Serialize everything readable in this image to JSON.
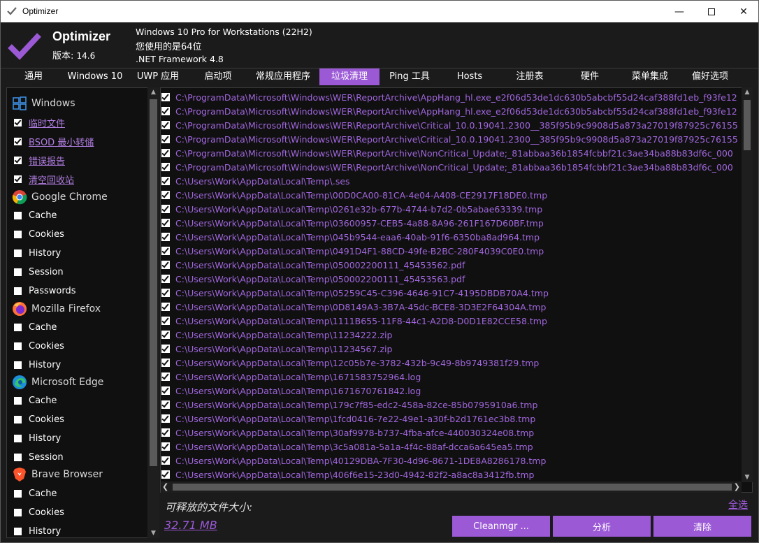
{
  "window": {
    "title": "Optimizer",
    "controls": [
      "minimize-icon",
      "maximize-icon",
      "close-icon"
    ]
  },
  "header": {
    "app_name": "Optimizer",
    "version_label": "版本:",
    "version_value": "14.6",
    "os": "Windows 10 Pro for Workstations (22H2)",
    "arch": "您使用的是64位",
    "framework": ".NET Framework 4.8"
  },
  "tabs": [
    {
      "label": "通用"
    },
    {
      "label": "Windows 10"
    },
    {
      "label": "UWP 应用"
    },
    {
      "label": "启动项"
    },
    {
      "label": "常规应用程序"
    },
    {
      "label": "垃圾清理",
      "active": true
    },
    {
      "label": "Ping 工具"
    },
    {
      "label": "Hosts"
    },
    {
      "label": "注册表"
    },
    {
      "label": "硬件"
    },
    {
      "label": "菜单集成"
    },
    {
      "label": "偏好选项"
    }
  ],
  "sidebar": {
    "windows": {
      "label": "Windows",
      "icon": "windows-logo-icon",
      "items": [
        {
          "label": "临时文件",
          "checked": true
        },
        {
          "label": "BSOD 最小转储",
          "checked": true
        },
        {
          "label": "错误报告",
          "checked": true
        },
        {
          "label": "清空回收站",
          "checked": true
        }
      ]
    },
    "chrome": {
      "label": "Google Chrome",
      "icon": "chrome-logo-icon",
      "items": [
        {
          "label": "Cache",
          "checked": false
        },
        {
          "label": "Cookies",
          "checked": false
        },
        {
          "label": "History",
          "checked": false
        },
        {
          "label": "Session",
          "checked": false
        },
        {
          "label": "Passwords",
          "checked": false
        }
      ]
    },
    "firefox": {
      "label": "Mozilla Firefox",
      "icon": "firefox-logo-icon",
      "items": [
        {
          "label": "Cache",
          "checked": false
        },
        {
          "label": "Cookies",
          "checked": false
        },
        {
          "label": "History",
          "checked": false
        }
      ]
    },
    "edge": {
      "label": "Microsoft Edge",
      "icon": "edge-logo-icon",
      "items": [
        {
          "label": "Cache",
          "checked": false
        },
        {
          "label": "Cookies",
          "checked": false
        },
        {
          "label": "History",
          "checked": false
        },
        {
          "label": "Session",
          "checked": false
        }
      ]
    },
    "brave": {
      "label": "Brave Browser",
      "icon": "brave-logo-icon",
      "items": [
        {
          "label": "Cache",
          "checked": false
        },
        {
          "label": "Cookies",
          "checked": false
        },
        {
          "label": "History",
          "checked": false
        }
      ]
    }
  },
  "files": [
    "C:\\ProgramData\\Microsoft\\Windows\\WER\\ReportArchive\\AppHang_hl.exe_e2f06d53de1dc630b5abcbf55d24caf388fd1eb_f93fe12",
    "C:\\ProgramData\\Microsoft\\Windows\\WER\\ReportArchive\\AppHang_hl.exe_e2f06d53de1dc630b5abcbf55d24caf388fd1eb_f93fe12",
    "C:\\ProgramData\\Microsoft\\Windows\\WER\\ReportArchive\\Critical_10.0.19041.2300__385f95b9c9908d5a873a27019f87925c76155",
    "C:\\ProgramData\\Microsoft\\Windows\\WER\\ReportArchive\\Critical_10.0.19041.2300__385f95b9c9908d5a873a27019f87925c76155",
    "C:\\ProgramData\\Microsoft\\Windows\\WER\\ReportArchive\\NonCritical_Update;_81abbaa36b1854fcbbf21c3ae34ba88b83df6c_000",
    "C:\\ProgramData\\Microsoft\\Windows\\WER\\ReportArchive\\NonCritical_Update;_81abbaa36b1854fcbbf21c3ae34ba88b83df6c_000",
    "C:\\Users\\Work\\AppData\\Local\\Temp\\.ses",
    "C:\\Users\\Work\\AppData\\Local\\Temp\\00D0CA00-81CA-4e04-A408-CE2917F18DE0.tmp",
    "C:\\Users\\Work\\AppData\\Local\\Temp\\0261e32b-677b-4744-b7d2-0b5abae63339.tmp",
    "C:\\Users\\Work\\AppData\\Local\\Temp\\03600957-CEB5-4a88-8A96-261F167D60BF.tmp",
    "C:\\Users\\Work\\AppData\\Local\\Temp\\045b9544-eaa6-40ab-91f6-6350ba8ad964.tmp",
    "C:\\Users\\Work\\AppData\\Local\\Temp\\0491D4F1-88CD-49fe-B2BC-280F4039C0E0.tmp",
    "C:\\Users\\Work\\AppData\\Local\\Temp\\050002200111_45453562.pdf",
    "C:\\Users\\Work\\AppData\\Local\\Temp\\050002200111_45453563.pdf",
    "C:\\Users\\Work\\AppData\\Local\\Temp\\05259C45-C396-4646-91C7-4195DBDB70A4.tmp",
    "C:\\Users\\Work\\AppData\\Local\\Temp\\0D8149A3-3B7A-45dc-BCE8-3D3E2F64304A.tmp",
    "C:\\Users\\Work\\AppData\\Local\\Temp\\1111B655-11F8-44c1-A2D8-D0D1E82CCE58.tmp",
    "C:\\Users\\Work\\AppData\\Local\\Temp\\11234222.zip",
    "C:\\Users\\Work\\AppData\\Local\\Temp\\11234567.zip",
    "C:\\Users\\Work\\AppData\\Local\\Temp\\12c05b7e-3782-432b-9c49-8b9749381f29.tmp",
    "C:\\Users\\Work\\AppData\\Local\\Temp\\1671583752964.log",
    "C:\\Users\\Work\\AppData\\Local\\Temp\\1671670761842.log",
    "C:\\Users\\Work\\AppData\\Local\\Temp\\179c7f85-edc2-458a-82ce-85b0795910a6.tmp",
    "C:\\Users\\Work\\AppData\\Local\\Temp\\1fcd0416-7e22-49e1-a30f-b2d1761ec3b8.tmp",
    "C:\\Users\\Work\\AppData\\Local\\Temp\\30af9978-b737-4fba-afce-440030324e08.tmp",
    "C:\\Users\\Work\\AppData\\Local\\Temp\\3c5a081a-5a1a-4f4c-88af-dcca6a645ea5.tmp",
    "C:\\Users\\Work\\AppData\\Local\\Temp\\40129DBA-7F30-4d96-8671-1DE8A8286178.tmp",
    "C:\\Users\\Work\\AppData\\Local\\Temp\\406f6e15-23d0-4942-82f2-a8ac8a3412fb.tmp"
  ],
  "footer": {
    "size_label": "可释放的文件大小:",
    "size_value": "32.71 MB",
    "select_all": "全选",
    "buttons": {
      "cleanmgr": "Cleanmgr ...",
      "analyze": "分析",
      "clean": "清除"
    }
  },
  "colors": {
    "accent": "#9b59d6",
    "background": "#1b1b1b",
    "path_text": "#a066dd"
  }
}
